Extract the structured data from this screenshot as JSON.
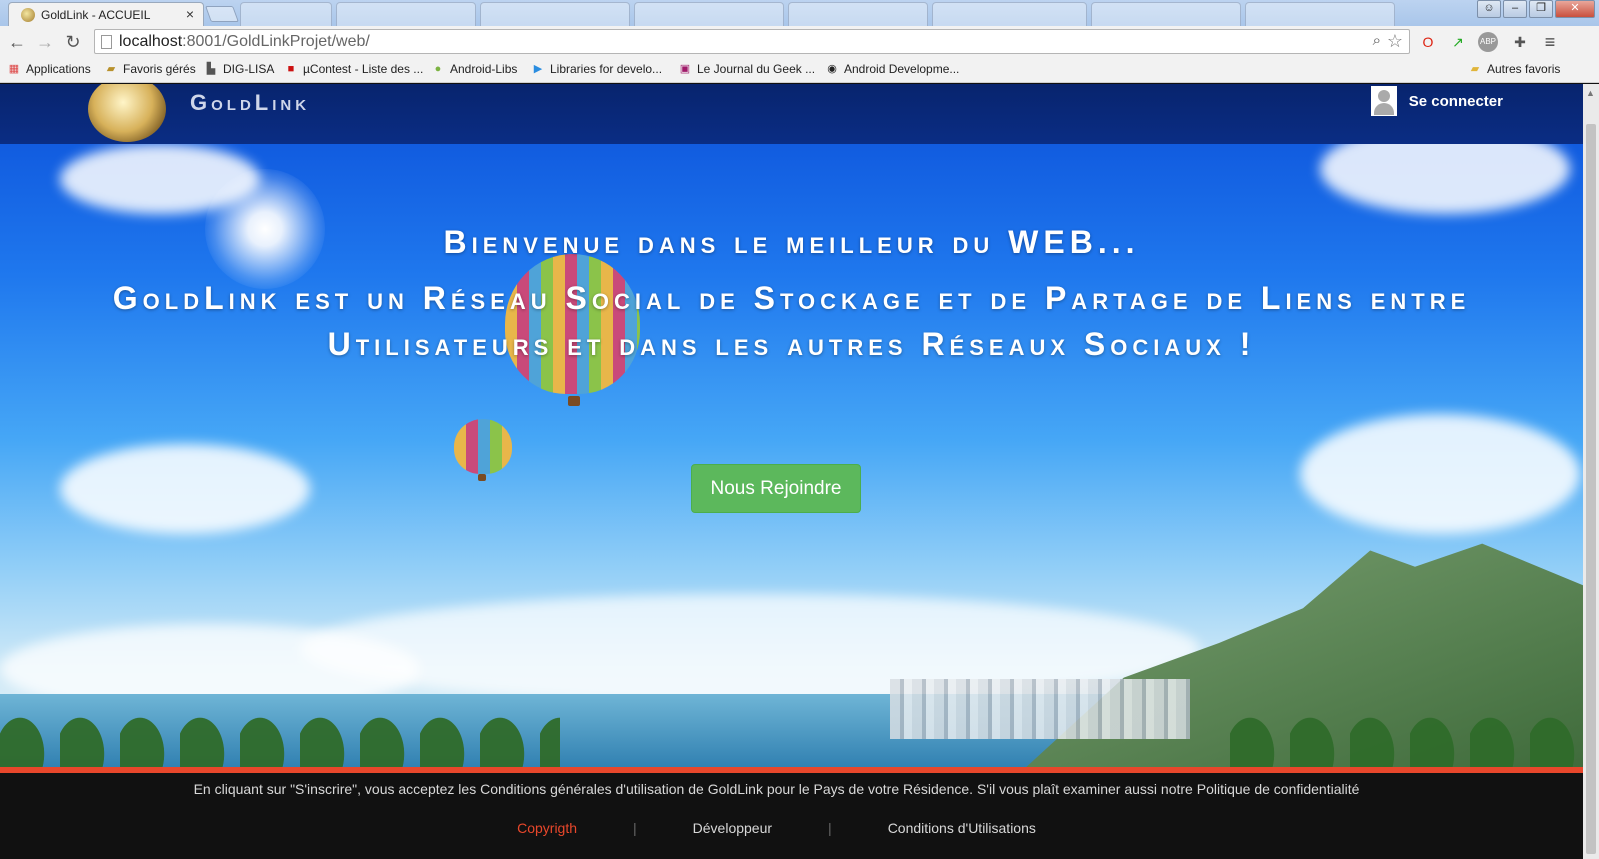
{
  "browser": {
    "tab_title": "GoldLink - ACCUEIL",
    "tab_close": "×",
    "url_host": "localhost",
    "url_rest": ":8001/GoldLinkProjet/web/",
    "back_glyph": "←",
    "forward_glyph": "→",
    "reload_glyph": "↻",
    "menu_glyph": "≡",
    "bookmarks": [
      {
        "label": "Applications",
        "icon": "apps-grid-icon"
      },
      {
        "label": "Favoris gérés",
        "icon": "folder-icon"
      },
      {
        "label": "DIG-LISA",
        "icon": "bookmark-icon"
      },
      {
        "label": "µContest - Liste des ...",
        "icon": "page-icon"
      },
      {
        "label": "Android-Libs",
        "icon": "android-icon"
      },
      {
        "label": "Libraries for develo...",
        "icon": "play-icon"
      },
      {
        "label": "Le Journal du Geek ...",
        "icon": "journal-icon"
      },
      {
        "label": "Android Developme...",
        "icon": "github-icon"
      }
    ],
    "other_bookmarks": "Autres favoris"
  },
  "site": {
    "brand": "GoldLink",
    "login_label": "Se connecter",
    "headline_1": "Bienvenue dans le meilleur du WEB...",
    "headline_2": "GoldLink est un Réseau Social de Stockage et de Partage de Liens entre Utilisateurs et dans les autres Réseaux Sociaux !",
    "cta_label": "Nous Rejoindre",
    "terms": "En cliquant sur \"S'inscrire\", vous acceptez les Conditions générales d'utilisation de GoldLink pour le Pays de votre Résidence. S'il vous plaît examiner aussi notre Politique de confidentialité",
    "footer_links": [
      "Copyrigth",
      "Développeur",
      "Conditions d'Utilisations"
    ],
    "separator": "|"
  },
  "colors": {
    "accent": "#e8472b",
    "cta": "#5cb85c",
    "topbar": "#0a2d84"
  }
}
